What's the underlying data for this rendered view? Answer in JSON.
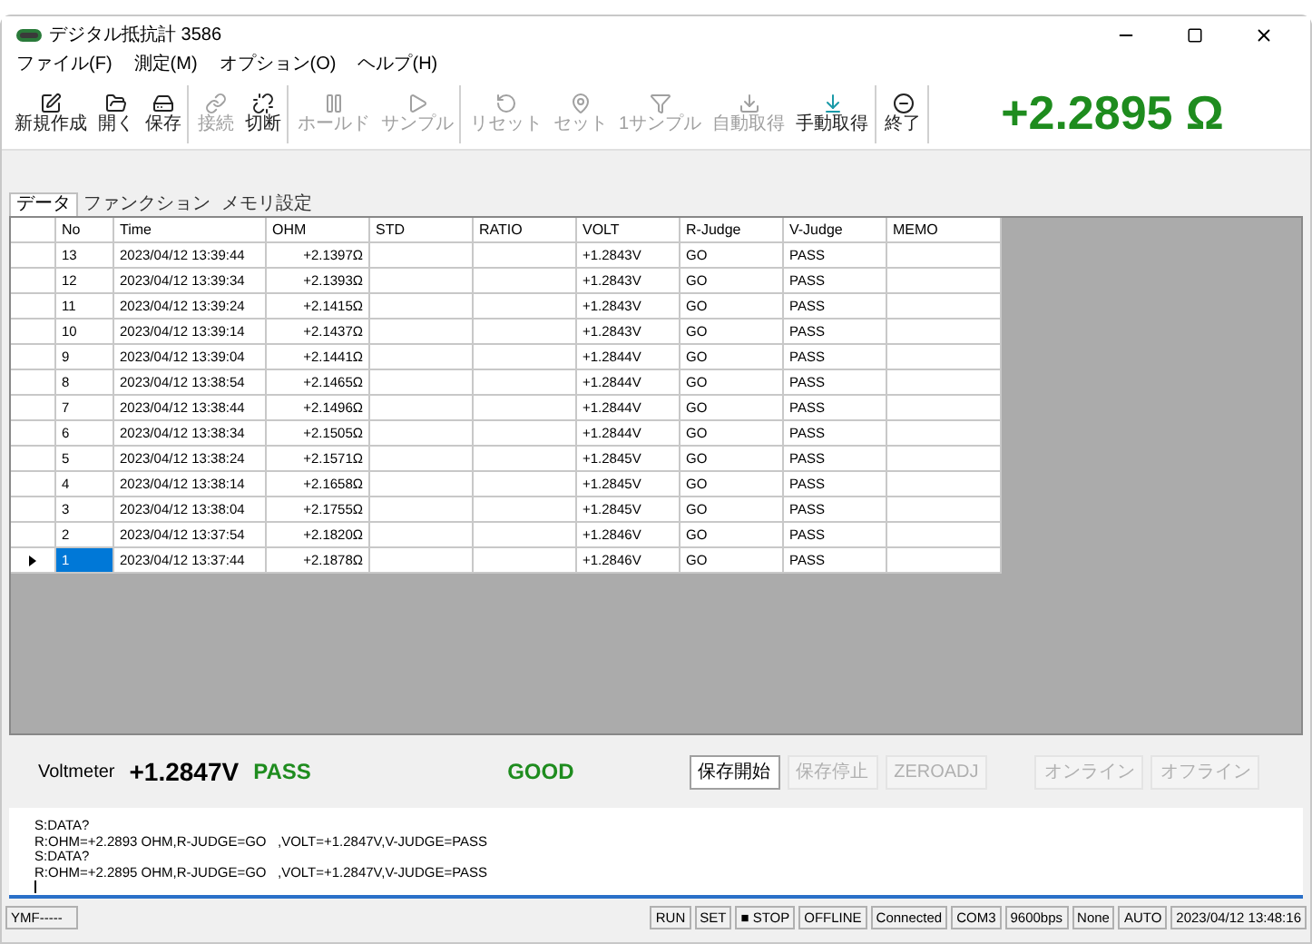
{
  "window": {
    "title": "デジタル抵抗計 3586"
  },
  "menu": [
    "ファイル(F)",
    "測定(M)",
    "オプション(O)",
    "ヘルプ(H)"
  ],
  "toolbar": {
    "groups": [
      [
        {
          "label": "新規作成",
          "disabled": false
        },
        {
          "label": "開く",
          "disabled": false
        },
        {
          "label": "保存",
          "disabled": false
        }
      ],
      [
        {
          "label": "接続",
          "disabled": true
        },
        {
          "label": "切断",
          "disabled": false
        }
      ],
      [
        {
          "label": "ホールド",
          "disabled": true
        },
        {
          "label": "サンプル",
          "disabled": true
        }
      ],
      [
        {
          "label": "リセット",
          "disabled": true
        },
        {
          "label": "セット",
          "disabled": true
        },
        {
          "label": "1サンプル",
          "disabled": true
        },
        {
          "label": "自動取得",
          "disabled": true
        },
        {
          "label": "手動取得",
          "disabled": false
        }
      ],
      [
        {
          "label": "終了",
          "disabled": false
        }
      ]
    ],
    "reading": "+2.2895 Ω"
  },
  "tabs": [
    {
      "label": "データ",
      "selected": true
    },
    {
      "label": "ファンクション",
      "selected": false
    },
    {
      "label": "メモリ設定",
      "selected": false
    }
  ],
  "table": {
    "columns": [
      "No",
      "Time",
      "OHM",
      "STD",
      "RATIO",
      "VOLT",
      "R-Judge",
      "V-Judge",
      "MEMO"
    ],
    "rows": [
      {
        "selected": false,
        "cells": [
          "13",
          "2023/04/12 13:39:44",
          "+2.1397Ω",
          "",
          "",
          "+1.2843V",
          "GO",
          "PASS",
          ""
        ]
      },
      {
        "selected": false,
        "cells": [
          "12",
          "2023/04/12 13:39:34",
          "+2.1393Ω",
          "",
          "",
          "+1.2843V",
          "GO",
          "PASS",
          ""
        ]
      },
      {
        "selected": false,
        "cells": [
          "11",
          "2023/04/12 13:39:24",
          "+2.1415Ω",
          "",
          "",
          "+1.2843V",
          "GO",
          "PASS",
          ""
        ]
      },
      {
        "selected": false,
        "cells": [
          "10",
          "2023/04/12 13:39:14",
          "+2.1437Ω",
          "",
          "",
          "+1.2843V",
          "GO",
          "PASS",
          ""
        ]
      },
      {
        "selected": false,
        "cells": [
          "9",
          "2023/04/12 13:39:04",
          "+2.1441Ω",
          "",
          "",
          "+1.2844V",
          "GO",
          "PASS",
          ""
        ]
      },
      {
        "selected": false,
        "cells": [
          "8",
          "2023/04/12 13:38:54",
          "+2.1465Ω",
          "",
          "",
          "+1.2844V",
          "GO",
          "PASS",
          ""
        ]
      },
      {
        "selected": false,
        "cells": [
          "7",
          "2023/04/12 13:38:44",
          "+2.1496Ω",
          "",
          "",
          "+1.2844V",
          "GO",
          "PASS",
          ""
        ]
      },
      {
        "selected": false,
        "cells": [
          "6",
          "2023/04/12 13:38:34",
          "+2.1505Ω",
          "",
          "",
          "+1.2844V",
          "GO",
          "PASS",
          ""
        ]
      },
      {
        "selected": false,
        "cells": [
          "5",
          "2023/04/12 13:38:24",
          "+2.1571Ω",
          "",
          "",
          "+1.2845V",
          "GO",
          "PASS",
          ""
        ]
      },
      {
        "selected": false,
        "cells": [
          "4",
          "2023/04/12 13:38:14",
          "+2.1658Ω",
          "",
          "",
          "+1.2845V",
          "GO",
          "PASS",
          ""
        ]
      },
      {
        "selected": false,
        "cells": [
          "3",
          "2023/04/12 13:38:04",
          "+2.1755Ω",
          "",
          "",
          "+1.2845V",
          "GO",
          "PASS",
          ""
        ]
      },
      {
        "selected": false,
        "cells": [
          "2",
          "2023/04/12 13:37:54",
          "+2.1820Ω",
          "",
          "",
          "+1.2846V",
          "GO",
          "PASS",
          ""
        ]
      },
      {
        "selected": true,
        "cells": [
          "1",
          "2023/04/12 13:37:44",
          "+2.1878Ω",
          "",
          "",
          "+1.2846V",
          "GO",
          "PASS",
          ""
        ]
      }
    ]
  },
  "voltmeter": {
    "label": "Voltmeter",
    "value": "+1.2847V",
    "judge": "PASS",
    "result": "GOOD"
  },
  "buttons": [
    {
      "label": "保存開始",
      "disabled": false
    },
    {
      "label": "保存停止",
      "disabled": true
    },
    {
      "label": "ZEROADJ",
      "disabled": true
    },
    {
      "label": "オンライン",
      "disabled": true
    },
    {
      "label": "オフライン",
      "disabled": true
    }
  ],
  "log": [
    "S:DATA?",
    "R:OHM=+2.2893 OHM,R-JUDGE=GO   ,VOLT=+1.2847V,V-JUDGE=PASS",
    "S:DATA?",
    "R:OHM=+2.2895 OHM,R-JUDGE=GO   ,VOLT=+1.2847V,V-JUDGE=PASS"
  ],
  "status_bar": {
    "left": "YMF-----",
    "items": [
      "RUN",
      "SET",
      "■ STOP",
      "OFFLINE",
      "Connected",
      "COM3",
      "9600bps",
      "None",
      "AUTO",
      "2023/04/12 13:48:16"
    ]
  }
}
